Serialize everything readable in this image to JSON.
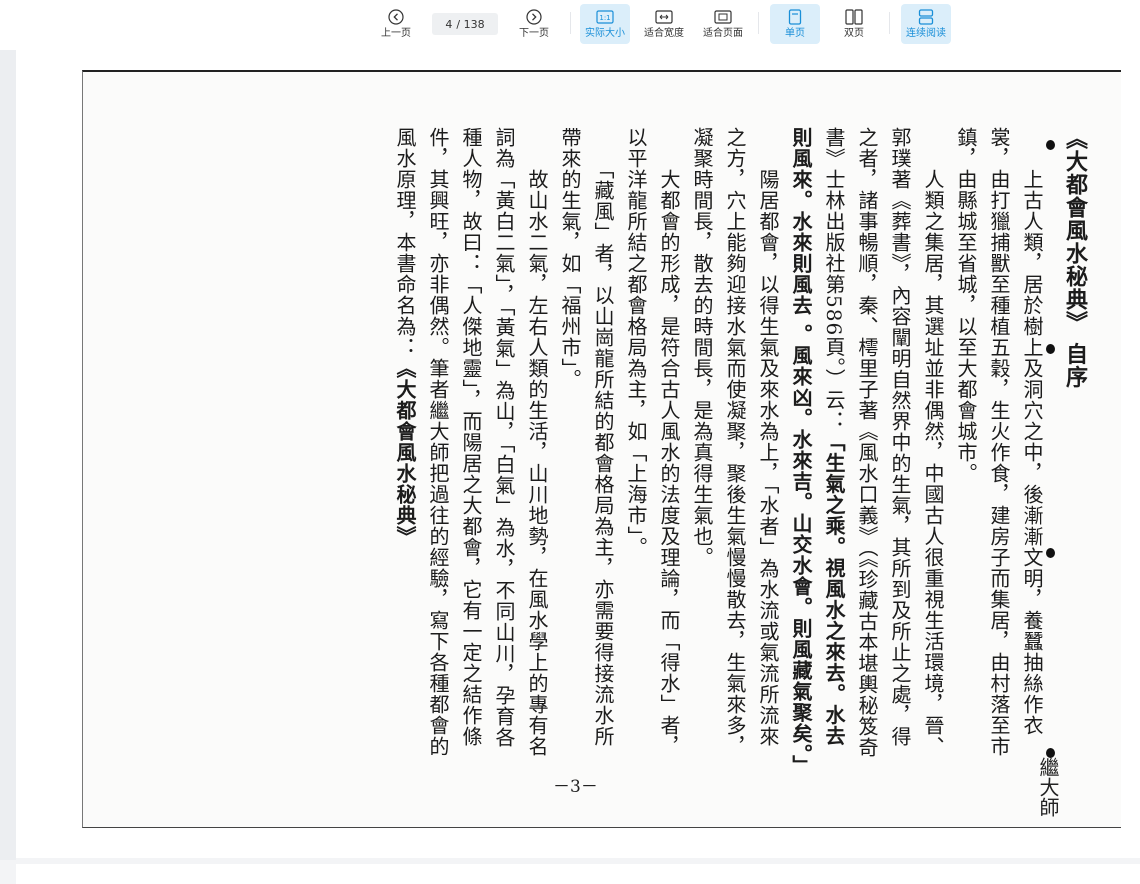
{
  "toolbar": {
    "prev_label": "上一页",
    "next_label": "下一页",
    "current_page": "4",
    "total_pages": "/ 138",
    "actual_size_label": "实际大小",
    "fit_width_label": "适合宽度",
    "fit_page_label": "适合页面",
    "single_page_label": "单页",
    "double_page_label": "双页",
    "continuous_label": "连续阅读",
    "actual_size_icon_text": "1:1"
  },
  "document": {
    "title": "《大都會風水秘典》 自序",
    "author": "繼大師",
    "page_number": "－3－",
    "paragraphs": [
      "　　上古人類，居於樹上及洞穴之中，後漸漸文明，養蠶抽絲作衣裳，由打獵捕獸至種植五穀，生火作食，建房子而集居，由村落至市鎮，由縣城至省城，以至大都會城市。",
      "　　人類之集居，其選址並非偶然，中國古人很重視生活環境，晉、郭璞著《葬書》，內容闡明自然界中的生氣，其所到及所止之處，得之者，諸事暢順，秦、樗里子著《風水口義》（《珍藏古本堪輿秘笈奇書》士林出版社第586頁。）云：",
      "「生氣之乘。視風水之來去。水去則風來。水來則風去 。風來凶。水來吉。山交水會。則風藏氣聚矣。」",
      "　　陽居都會，以得生氣及來水為上，「水者」為水流或氣流所流來之方，穴上能夠迎接水氣而使凝聚，聚後生氣慢慢散去，生氣來多，凝聚時間長，散去的時間長，是為真得生氣也。",
      "　　大都會的形成，是符合古人風水的法度及理論，而「得水」者，以平洋龍所結之都會格局為主，如「上海市」。",
      "　　「藏風」者，以山崗龍所結的都會格局為主，亦需要得接流水所帶來的生氣，如「福州市」。",
      "　　故山水二氣，左右人類的生活，山川地勢，在風水學上的專有名詞為「黃白二氣」，「黃氣」為山，「白氣」為水，不同山川，孕育各種人物，故曰：「人傑地靈」，而陽居之大都會，它有一定之結作條件，其興旺，亦非偶然。筆者繼大師把過往的經驗，寫下各種都會的風水原理，本書命名為：",
      "《大都會風水秘典》"
    ]
  }
}
